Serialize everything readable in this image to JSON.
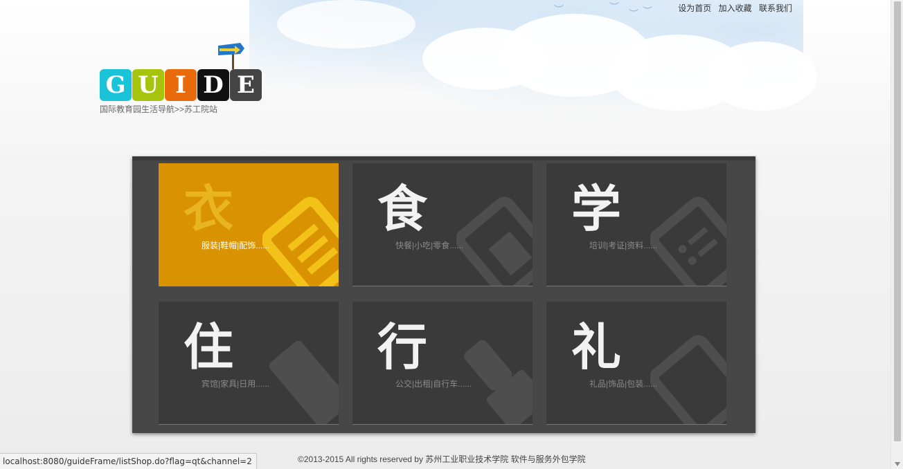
{
  "top_links": [
    "设为首页",
    "加入收藏",
    "联系我们"
  ],
  "logo": {
    "letters": [
      "G",
      "U",
      "I",
      "D",
      "E"
    ],
    "colors": [
      "#19c4d8",
      "#a6c40d",
      "#e86a0a",
      "#111111",
      "#444444"
    ]
  },
  "subtitle": "国际教育园生活导航>>苏工院站",
  "categories": [
    {
      "char": "衣",
      "sub": "服装|鞋帽|配饰......",
      "active": true
    },
    {
      "char": "食",
      "sub": "快餐|小吃|零食......"
    },
    {
      "char": "学",
      "sub": "培训|考证|资料......"
    },
    {
      "char": "住",
      "sub": "宾馆|家具|日用......"
    },
    {
      "char": "行",
      "sub": "公交|出租|自行车......"
    },
    {
      "char": "礼",
      "sub": "礼品|饰品|包装......"
    }
  ],
  "accent_color": "#d99200",
  "footer": "©2013-2015 All rights reserved by 苏州工业职业技术学院 软件与服务外包学院",
  "status_url": "localhost:8080/guideFrame/listShop.do?flag=qt&channel=2"
}
